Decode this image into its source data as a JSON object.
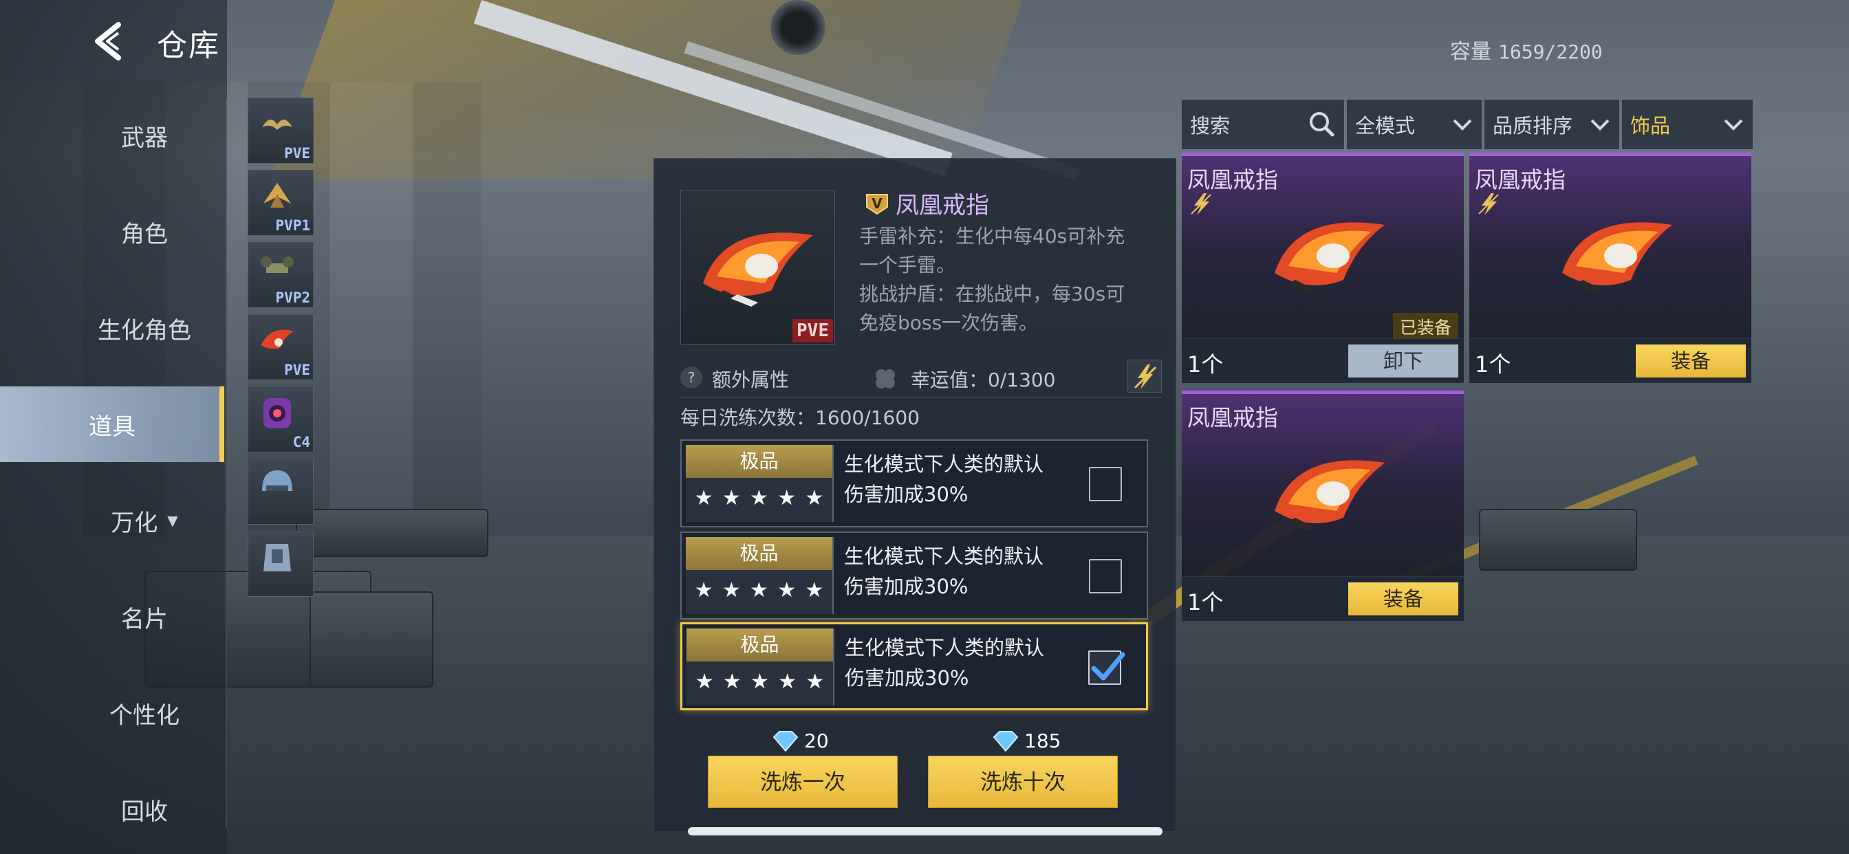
{
  "header": {
    "title": "仓库",
    "capacity_label": "容量",
    "capacity_value": "1659/2200"
  },
  "sidebar": {
    "items": [
      {
        "label": "武器"
      },
      {
        "label": "角色"
      },
      {
        "label": "生化角色"
      },
      {
        "label": "道具",
        "active": true
      },
      {
        "label": "万化"
      },
      {
        "label": "名片"
      },
      {
        "label": "个性化"
      },
      {
        "label": "回收"
      }
    ]
  },
  "strip": {
    "items": [
      {
        "tag": "PVE",
        "icon": "wings-icon"
      },
      {
        "tag": "PVP1",
        "icon": "wings-gold-icon"
      },
      {
        "tag": "PVP2",
        "icon": "drone-icon"
      },
      {
        "tag": "PVE",
        "icon": "phoenix-ring-icon"
      },
      {
        "tag": "C4",
        "icon": "c4-bomb-icon"
      },
      {
        "tag": "",
        "icon": "helmet-icon"
      },
      {
        "tag": "",
        "icon": "armor-icon"
      }
    ]
  },
  "detail": {
    "name": "凤凰戒指",
    "thumb_tag": "PVE",
    "desc_line1": "手雷补充：生化中每40s可补充",
    "desc_line2": "一个手雷。",
    "desc_line3": "挑战护盾：在挑战中，每30s可",
    "desc_line4": "免疫boss一次伤害。",
    "extra_attr": "额外属性",
    "luck_label": "幸运值：0/1300",
    "daily_label": "每日洗练次数：1600/1600",
    "rerolls": [
      {
        "grade": "极品",
        "stars": [
          "★",
          "★",
          "★",
          "★",
          "★"
        ],
        "line1": "生化模式下人类的默认",
        "line2": "伤害加成30%",
        "checked": false
      },
      {
        "grade": "极品",
        "stars": [
          "★",
          "★",
          "★",
          "★",
          "★"
        ],
        "line1": "生化模式下人类的默认",
        "line2": "伤害加成30%",
        "checked": false
      },
      {
        "grade": "极品",
        "stars": [
          "★",
          "★",
          "★",
          "★",
          "★"
        ],
        "line1": "生化模式下人类的默认",
        "line2": "伤害加成30%",
        "checked": true
      }
    ],
    "cost_once": "20",
    "cost_ten": "185",
    "btn_once": "洗炼一次",
    "btn_ten": "洗炼十次"
  },
  "filters": {
    "search_placeholder": "搜索",
    "mode": "全模式",
    "sort": "品质排序",
    "category": "饰品"
  },
  "cards": [
    {
      "name": "凤凰戒指",
      "count": "1个",
      "action": "卸下",
      "equipped_badge": "已装备"
    },
    {
      "name": "凤凰戒指",
      "count": "1个",
      "action": "装备"
    },
    {
      "name": "凤凰戒指",
      "count": "1个",
      "action": "装备"
    }
  ],
  "colors": {
    "accent_yellow": "#f2c94c",
    "rarity_purple": "#a25fdc",
    "pve_red": "#8b1f24"
  }
}
